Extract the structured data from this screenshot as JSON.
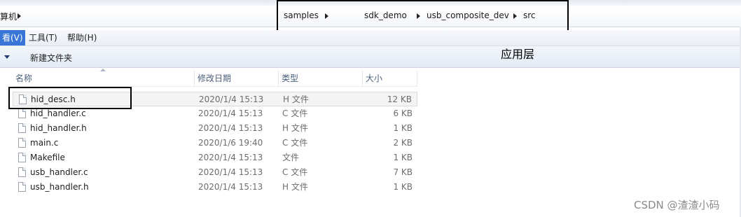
{
  "address": {
    "left_fragment": "算机",
    "crumbs": [
      "samples",
      "sdk_demo",
      "usb_composite_dev",
      "src"
    ]
  },
  "menu": {
    "items": [
      "看(V)",
      "工具(T)",
      "帮助(H)"
    ]
  },
  "toolbar": {
    "new_folder": "新建文件夹"
  },
  "annotation": {
    "label": "应用层"
  },
  "columns": [
    "名称",
    "修改日期",
    "类型",
    "大小"
  ],
  "files": [
    {
      "name": "hid_desc.h",
      "date": "2020/1/4 15:13",
      "type": "H 文件",
      "size": "12 KB"
    },
    {
      "name": "hid_handler.c",
      "date": "2020/1/4 15:13",
      "type": "C 文件",
      "size": "6 KB"
    },
    {
      "name": "hid_handler.h",
      "date": "2020/1/4 15:13",
      "type": "H 文件",
      "size": "1 KB"
    },
    {
      "name": "main.c",
      "date": "2020/1/6 19:40",
      "type": "C 文件",
      "size": "2 KB"
    },
    {
      "name": "Makefile",
      "date": "2020/1/4 15:13",
      "type": "文件",
      "size": "1 KB"
    },
    {
      "name": "usb_handler.c",
      "date": "2020/1/4 15:13",
      "type": "C 文件",
      "size": "7 KB"
    },
    {
      "name": "usb_handler.h",
      "date": "2020/1/4 15:13",
      "type": "H 文件",
      "size": "1 KB"
    }
  ],
  "watermark": "CSDN @渣渣小码"
}
